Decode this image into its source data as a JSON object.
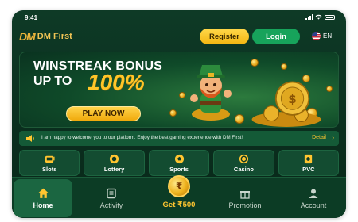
{
  "status_bar": {
    "time": "9:41"
  },
  "header": {
    "logo_mark": "DM",
    "brand": "DM First",
    "register_label": "Register",
    "login_label": "Login",
    "language": "EN"
  },
  "banner": {
    "line1": "WINSTREAK BONUS",
    "line2": "UP TO",
    "percent": "100%",
    "cta_label": "PLAY NOW"
  },
  "notice": {
    "message": "I am happy to welcome you to our platform. Enjoy the best gaming experience with DM First!",
    "detail_label": "Detail",
    "detail_chevron": "›"
  },
  "categories": [
    {
      "label": "Slots",
      "icon": "slot-machine-icon"
    },
    {
      "label": "Lottery",
      "icon": "lottery-ball-icon"
    },
    {
      "label": "Sports",
      "icon": "soccer-ball-icon"
    },
    {
      "label": "Casino",
      "icon": "casino-chip-icon"
    },
    {
      "label": "PVC",
      "icon": "pvc-icon"
    }
  ],
  "bottom_nav": {
    "home": "Home",
    "activity": "Activity",
    "get_bonus": "Get ₹500",
    "promotion": "Promotion",
    "account": "Account"
  },
  "colors": {
    "background": "#0a2e1e",
    "accent_gold": "#ffc528",
    "login_green": "#17a35b"
  }
}
